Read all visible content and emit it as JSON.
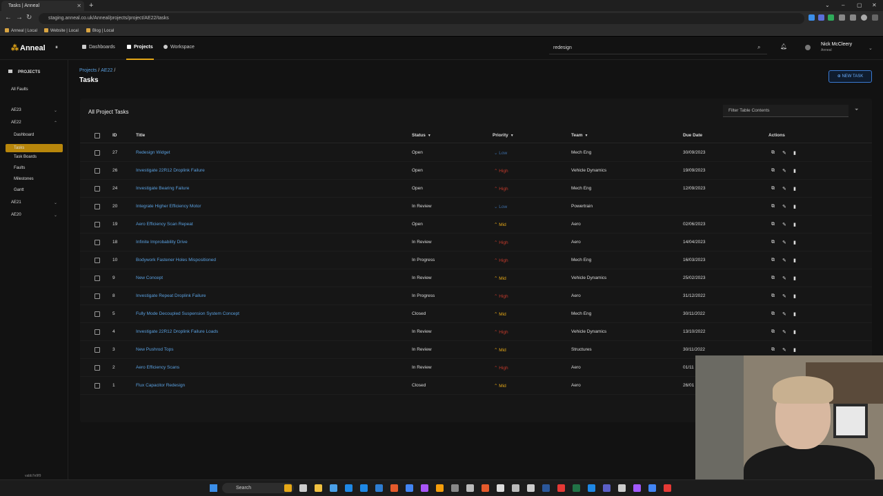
{
  "browser": {
    "tab_title": "Tasks | Anneal",
    "url": "staging.anneal.co.uk/Anneal/projects/project/AE22/tasks",
    "bookmarks": [
      "Anneal | Local",
      "Website | Local",
      "Blog | Local"
    ]
  },
  "topnav": {
    "logo": "Anneal",
    "items": [
      "Dashboards",
      "Projects",
      "Workspace"
    ],
    "active": "Projects",
    "search_value": "redesign",
    "user_name": "Nick McCleery",
    "user_org": "Anneal"
  },
  "sidebar": {
    "section": "PROJECTS",
    "all_faults": "All Faults",
    "projects": [
      "AE23",
      "AE22",
      "AE21",
      "AE20"
    ],
    "ae22_items": [
      "Dashboard",
      "Tasks",
      "Task Boards",
      "Faults",
      "Milestones",
      "Gantt"
    ],
    "active_item": "Tasks",
    "footer": "vabb7e9f9"
  },
  "page": {
    "breadcrumb": [
      "Projects",
      "AE22",
      ""
    ],
    "title": "Tasks",
    "new_task_label": "NEW TASK"
  },
  "table": {
    "title": "All Project Tasks",
    "filter_placeholder": "Filter Table Contents",
    "headers": {
      "id": "ID",
      "title": "Title",
      "status": "Status",
      "priority": "Priority",
      "team": "Team",
      "due": "Due Date",
      "actions": "Actions"
    },
    "rows": [
      {
        "id": "27",
        "title": "Redesign Widget",
        "status": "Open",
        "priority": "Low",
        "team": "Mech Eng",
        "due": "30/09/2023"
      },
      {
        "id": "26",
        "title": "Investigate 22R12 Droplink Failure",
        "status": "Open",
        "priority": "High",
        "team": "Vehicle Dynamics",
        "due": "19/09/2023"
      },
      {
        "id": "24",
        "title": "Investigate Bearing Failure",
        "status": "Open",
        "priority": "High",
        "team": "Mech Eng",
        "due": "12/09/2023"
      },
      {
        "id": "20",
        "title": "Integrate Higher Efficiency Motor",
        "status": "In Review",
        "priority": "Low",
        "team": "Powertrain",
        "due": ""
      },
      {
        "id": "19",
        "title": "Aero Efficiency Scan Repeat",
        "status": "Open",
        "priority": "Mid",
        "team": "Aero",
        "due": "02/06/2023"
      },
      {
        "id": "18",
        "title": "Infinite Improbability Drive",
        "status": "In Review",
        "priority": "High",
        "team": "Aero",
        "due": "14/04/2023"
      },
      {
        "id": "10",
        "title": "Bodywork Fastener Holes Mispositioned",
        "status": "In Progress",
        "priority": "High",
        "team": "Mech Eng",
        "due": "16/03/2023"
      },
      {
        "id": "9",
        "title": "New Concept",
        "status": "In Review",
        "priority": "Mid",
        "team": "Vehicle Dynamics",
        "due": "25/02/2023"
      },
      {
        "id": "8",
        "title": "Investigate Repeat Droplink Failure",
        "status": "In Progress",
        "priority": "High",
        "team": "Aero",
        "due": "31/12/2022"
      },
      {
        "id": "5",
        "title": "Fully Mode Decoupled Suspension System Concept",
        "status": "Closed",
        "priority": "Mid",
        "team": "Mech Eng",
        "due": "30/11/2022"
      },
      {
        "id": "4",
        "title": "Investigate 22R12 Droplink Failure Loads",
        "status": "In Review",
        "priority": "High",
        "team": "Vehicle Dynamics",
        "due": "13/10/2022"
      },
      {
        "id": "3",
        "title": "New Pushrod Tops",
        "status": "In Review",
        "priority": "Mid",
        "team": "Structures",
        "due": "30/11/2022"
      },
      {
        "id": "2",
        "title": "Aero Efficiency Scans",
        "status": "In Review",
        "priority": "High",
        "team": "Aero",
        "due": "01/11"
      },
      {
        "id": "1",
        "title": "Flux Capacitor Redesign",
        "status": "Closed",
        "priority": "Mid",
        "team": "Aero",
        "due": "26/01"
      }
    ]
  },
  "taskbar": {
    "search_label": "Search"
  },
  "colors": {
    "accent": "#e6a817",
    "link": "#5aa0e0",
    "high": "#c0392b",
    "low": "#3d6fa8"
  }
}
